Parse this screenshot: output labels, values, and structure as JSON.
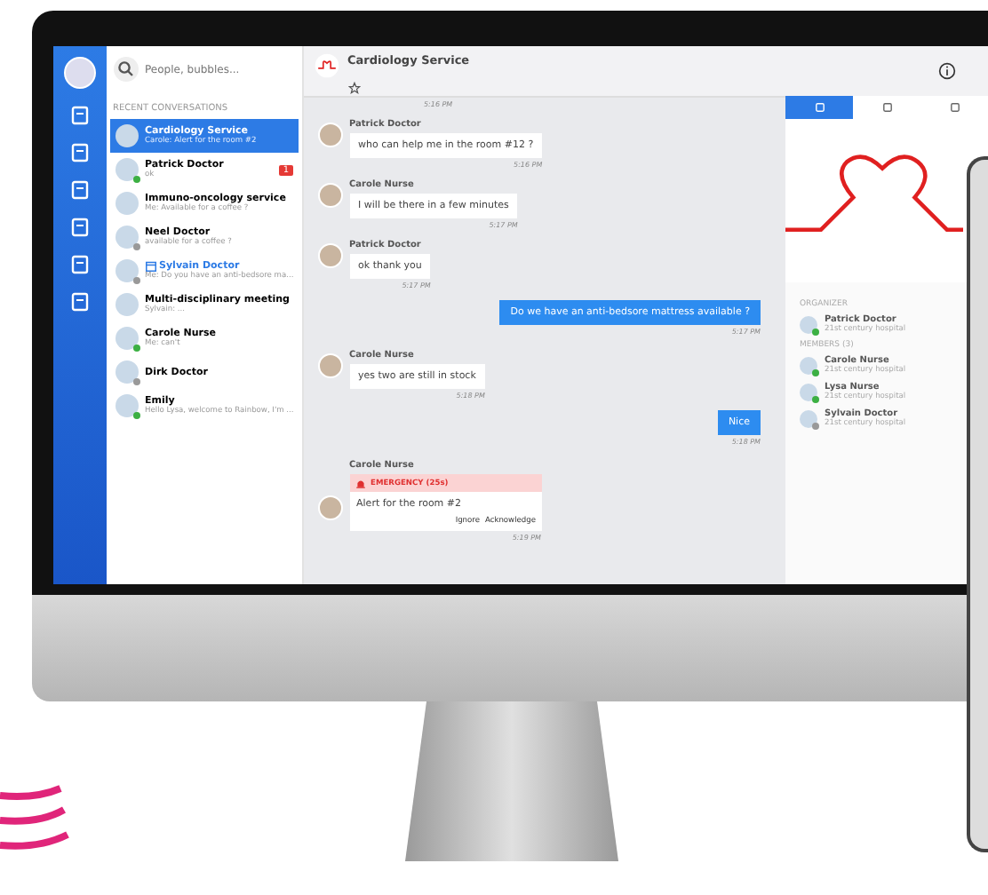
{
  "sidebar": {
    "search": {
      "placeholder": "People, bubbles..."
    },
    "section": "RECENT CONVERSATIONS",
    "conversations": [
      {
        "name": "Cardiology Service",
        "preview": "Carole: Alert for the room #2",
        "selected": true,
        "meeting": false
      },
      {
        "name": "Patrick Doctor",
        "preview": "ok",
        "selected": false,
        "online": true,
        "meeting": false,
        "badge": "1"
      },
      {
        "name": "Immuno-oncology service",
        "preview": "Me: Available for a coffee ?",
        "selected": false,
        "meeting": false
      },
      {
        "name": "Neel Doctor",
        "preview": "available for a coffee ?",
        "selected": false,
        "online": false,
        "meeting": false
      },
      {
        "name": "Sylvain Doctor",
        "preview": "Me: Do you have an anti-bedsore ma...",
        "selected": false,
        "online": false,
        "meeting": true
      },
      {
        "name": "Multi-disciplinary meeting",
        "preview": "Sylvain: ...",
        "selected": false,
        "meeting": false
      },
      {
        "name": "Carole Nurse",
        "preview": "Me: can't",
        "selected": false,
        "online": true,
        "meeting": false
      },
      {
        "name": "Dirk Doctor",
        "selected": false,
        "online": false,
        "meeting": false
      },
      {
        "name": "Emily",
        "preview": "Hello Lysa, welcome to Rainbow, I'm ...",
        "selected": false,
        "online": true,
        "meeting": false
      }
    ]
  },
  "chat": {
    "title": "Cardiology Service",
    "messages": [
      {
        "kind": "time",
        "time": "5:16 PM"
      },
      {
        "kind": "incoming",
        "sender": "Patrick Doctor",
        "text": "who can help me in the room #12 ?",
        "time": "5:16 PM"
      },
      {
        "kind": "incoming",
        "sender": "Carole Nurse",
        "text": "I will be there in a few minutes",
        "time": "5:17 PM"
      },
      {
        "kind": "incoming",
        "sender": "Patrick Doctor",
        "text": "ok thank you",
        "time": "5:17 PM"
      },
      {
        "kind": "outgoing",
        "text": "Do we have an anti-bedsore mattress available ?",
        "time": "5:17 PM"
      },
      {
        "kind": "incoming",
        "sender": "Carole Nurse",
        "text": "yes two are still in stock",
        "time": "5:18 PM"
      },
      {
        "kind": "outgoing",
        "text": "Nice",
        "time": "5:18 PM"
      },
      {
        "kind": "alert",
        "sender": "Carole Nurse",
        "label": "EMERGENCY (25s)",
        "text": "Alert for the room #2",
        "actions": [
          "Ignore",
          "Acknowledge"
        ],
        "time": "5:19 PM"
      }
    ]
  },
  "panel": {
    "tabs": [
      {
        "selected": true
      },
      {
        "selected": false
      },
      {
        "selected": false
      }
    ],
    "organizer_heading": "ORGANIZER",
    "organizer": {
      "name": "Patrick Doctor",
      "org": "21st century hospital",
      "online": true
    },
    "members_heading": "MEMBERS (3)",
    "members": [
      {
        "name": "Carole Nurse",
        "org": "21st century hospital",
        "online": true
      },
      {
        "name": "Lysa Nurse",
        "org": "21st century hospital",
        "online": true
      },
      {
        "name": "Sylvain Doctor",
        "org": "21st century hospital",
        "online": false
      }
    ]
  }
}
